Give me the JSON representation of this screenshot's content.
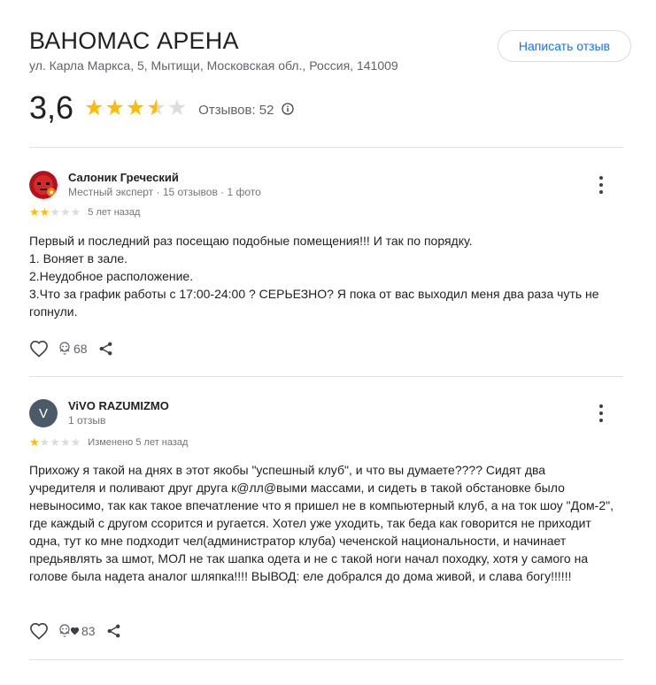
{
  "place": {
    "title": "ВАНОМАС АРЕНА",
    "address": "ул. Карла Маркса, 5, Мытищи, Московская обл., Россия, 141009",
    "write_review_label": "Написать отзыв",
    "rating": "3,6",
    "rating_stars": 3.5,
    "reviews_label": "Отзывов: 52"
  },
  "reviews": [
    {
      "author": "Салоник Греческий",
      "meta": "Местный эксперт · 15 отзывов · 1 фото",
      "stars": 2,
      "time": "5 лет назад",
      "text_lines": [
        "Первый и последний раз посещаю подобные помещения!!! И так по порядку.",
        "1. Воняет в зале.",
        "2.Неудобное расположение.",
        "3.Что за график работы с 17:00-24:00 ? СЕРЬЕЗНО? Я пока от вас выходил меня два раза чуть не гопнули."
      ],
      "likes": "68"
    },
    {
      "author": "ViVO RAZUMIZMO",
      "avatar_letter": "V",
      "meta": "1 отзыв",
      "stars": 1,
      "time": "Изменено 5 лет назад",
      "text": "Прихожу я такой на днях в этот якобы \"успешный клуб\", и что вы думаете???? Сидят два учредителя и поливают друг друга к@лл@выми массами, и сидеть в такой обстановке было невыносимо, так как такое впечатление что я пришел не в компьютерный клуб, а на ток шоу \"Дом-2\", где каждый с другом ссорится и ругается. Хотел уже уходить, так беда как говорится не приходит одна, тут ко мне подходит чел(администратор клуба) чеченской национальности, и начинает предьявлять за шмот, МОЛ не так шапка одета и не с такой ноги начал походку, хотя у самого на голове была надета аналог шляпка!!!! ВЫВОД: еле добрался до дома живой, и слава богу!!!!!!",
      "likes": "83"
    }
  ],
  "colors": {
    "star": "#fbbc04",
    "star_empty": "#dadce0",
    "link_blue": "#1a73e8"
  }
}
